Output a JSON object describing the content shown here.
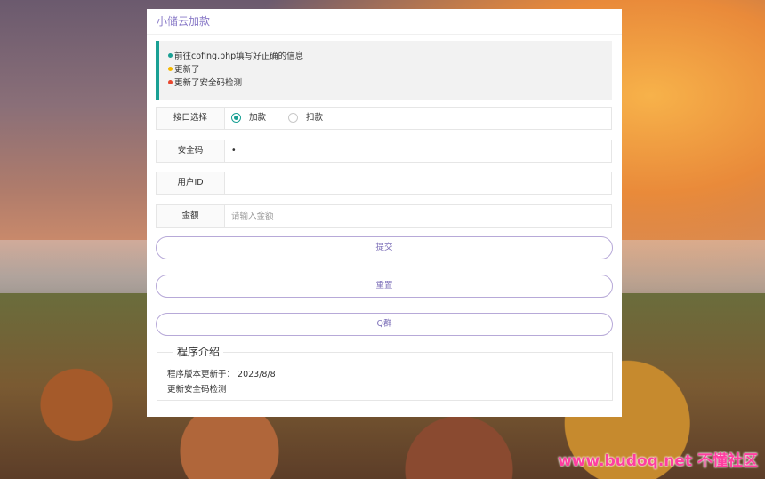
{
  "app": {
    "title": "小储云加款"
  },
  "notice": {
    "lines": [
      {
        "text": "前往cofing.php填写好正确的信息",
        "color": "#1aa094"
      },
      {
        "text": "更新了",
        "color": "#f5b800"
      },
      {
        "text": "更新了安全码检测",
        "color": "#e8472f"
      }
    ]
  },
  "form": {
    "interface": {
      "label": "接口选择",
      "options": [
        "加款",
        "扣款"
      ],
      "selected": "加款"
    },
    "security_code": {
      "label": "安全码",
      "value": "•"
    },
    "user_id": {
      "label": "用户ID",
      "value": ""
    },
    "amount": {
      "label": "金额",
      "placeholder": "请输入金额"
    }
  },
  "buttons": {
    "submit": "提交",
    "reset": "重置",
    "qgroup": "Q群"
  },
  "intro": {
    "legend": "程序介绍",
    "line1": "程序版本更新于： 2023/8/8",
    "line2": "更新安全码检测"
  },
  "watermark": "www.budoq.net 不懂社区",
  "colors": {
    "accent": "#1aa094",
    "button_text": "#7c6fb8",
    "title": "#8a7bc8"
  }
}
